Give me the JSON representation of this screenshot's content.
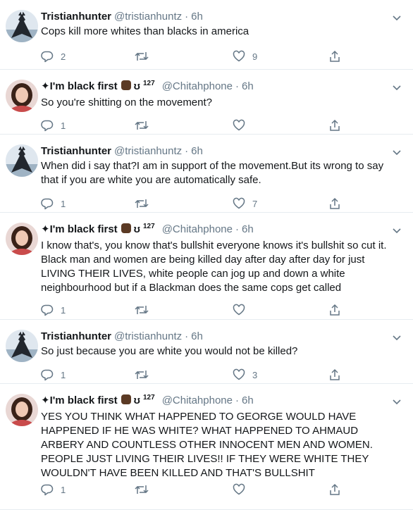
{
  "colors": {
    "text": "#14171a",
    "secondary": "#657786",
    "divider": "#e6ecf0",
    "fist": "#5b3a24"
  },
  "icons": {
    "reply": "reply-icon",
    "retweet": "retweet-icon",
    "like": "heart-icon",
    "share": "share-icon",
    "caret": "chevron-down-icon"
  },
  "tweets": [
    {
      "name": "Tristianhunter",
      "handle": "@tristianhuntz",
      "separator": "·",
      "time": "6h",
      "text": "Cops kill more whites than blacks in america",
      "replies": "2",
      "retweets": "",
      "likes": "9"
    },
    {
      "name": "✦I'm black first",
      "emoji_symbol": "ʊ",
      "sup": "127",
      "handle": "@Chitahphone",
      "separator": "·",
      "time": "6h",
      "text": "So you're shitting on the movement?",
      "replies": "1",
      "retweets": "",
      "likes": ""
    },
    {
      "name": "Tristianhunter",
      "handle": "@tristianhuntz",
      "separator": "·",
      "time": "6h",
      "text": "When did i say that?I am in support of the movement.But its wrong to say that if you are white you are automatically safe.",
      "replies": "1",
      "retweets": "",
      "likes": "7"
    },
    {
      "name": "✦I'm black first",
      "emoji_symbol": "ʊ",
      "sup": "127",
      "handle": "@Chitahphone",
      "separator": "·",
      "time": "6h",
      "text": "I know that's, you know that's bullshit everyone knows it's bullshit so cut it. Black man and women are being killed day after day after day for just LIVING THEIR LIVES, white people can jog up and down a white neighbourhood but if a Blackman does the same cops get called",
      "replies": "1",
      "retweets": "",
      "likes": ""
    },
    {
      "name": "Tristianhunter",
      "handle": "@tristianhuntz",
      "separator": "·",
      "time": "6h",
      "text": "So just because you are white you would not be killed?",
      "replies": "1",
      "retweets": "",
      "likes": "3"
    },
    {
      "name": "✦I'm black first",
      "emoji_symbol": "ʊ",
      "sup": "127",
      "handle": "@Chitahphone",
      "separator": "·",
      "time": "6h",
      "text": "YES YOU THINK WHAT HAPPENED TO GEORGE WOULD HAVE HAPPENED IF HE WAS WHITE? WHAT HAPPENED TO AHMAUD  ARBERY AND COUNTLESS OTHER INNOCENT MEN AND WOMEN. PEOPLE JUST LIVING THEIR LIVES!! IF THEY WERE WHITE THEY WOULDN'T HAVE BEEN KILLED AND THAT'S BULLSHIT",
      "replies": "1",
      "retweets": "",
      "likes": ""
    }
  ]
}
